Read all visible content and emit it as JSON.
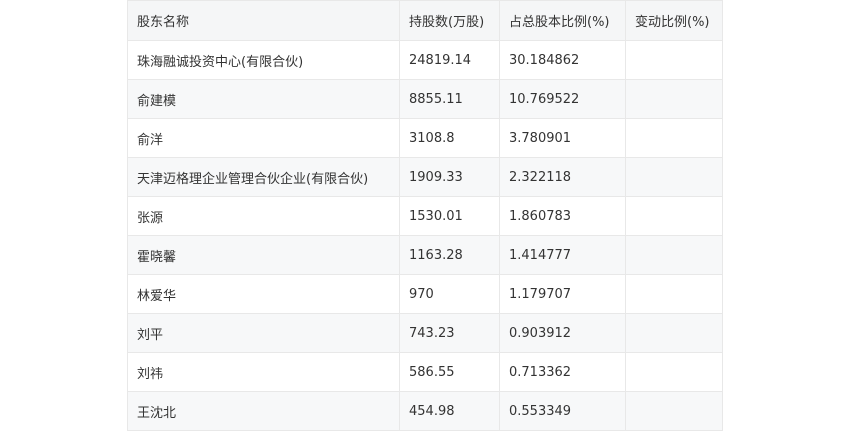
{
  "table": {
    "headers": [
      "股东名称",
      "持股数(万股)",
      "占总股本比例(%)",
      "变动比例(%)"
    ],
    "rows": [
      [
        "珠海融诚投资中心(有限合伙)",
        "24819.14",
        "30.184862",
        ""
      ],
      [
        "俞建模",
        "8855.11",
        "10.769522",
        ""
      ],
      [
        "俞洋",
        "3108.8",
        "3.780901",
        ""
      ],
      [
        "天津迈格理企业管理合伙企业(有限合伙)",
        "1909.33",
        "2.322118",
        ""
      ],
      [
        "张源",
        "1530.01",
        "1.860783",
        ""
      ],
      [
        "霍晓馨",
        "1163.28",
        "1.414777",
        ""
      ],
      [
        "林爱华",
        "970",
        "1.179707",
        ""
      ],
      [
        "刘平",
        "743.23",
        "0.903912",
        ""
      ],
      [
        "刘祎",
        "586.55",
        "0.713362",
        ""
      ],
      [
        "王沈北",
        "454.98",
        "0.553349",
        ""
      ]
    ]
  }
}
